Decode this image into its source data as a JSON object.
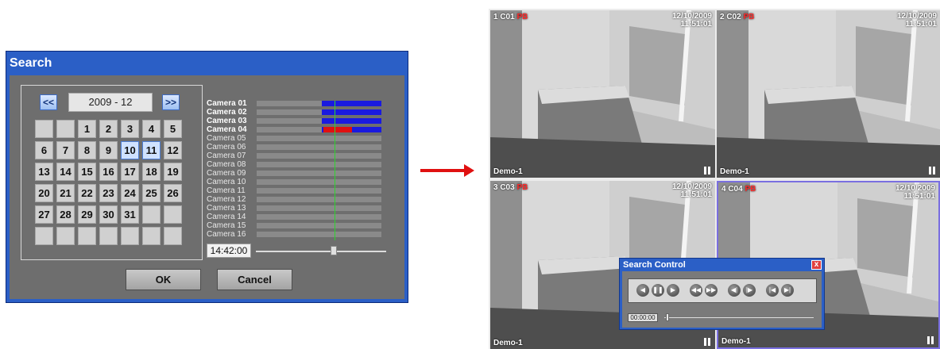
{
  "search_dialog": {
    "title": "Search",
    "prev_label": "<<",
    "next_label": ">>",
    "month": "2009 - 12",
    "days": [
      "",
      "",
      "1",
      "2",
      "3",
      "4",
      "5",
      "6",
      "7",
      "8",
      "9",
      "10",
      "11",
      "12",
      "13",
      "14",
      "15",
      "16",
      "17",
      "18",
      "19",
      "20",
      "21",
      "22",
      "23",
      "24",
      "25",
      "26",
      "27",
      "28",
      "29",
      "30",
      "31",
      "",
      "",
      "",
      "",
      "",
      "",
      "",
      "",
      ""
    ],
    "selected_days": [
      "10",
      "11"
    ],
    "cameras": [
      "Camera 01",
      "Camera 02",
      "Camera 03",
      "Camera 04",
      "Camera 05",
      "Camera 06",
      "Camera 07",
      "Camera 08",
      "Camera 09",
      "Camera 10",
      "Camera 11",
      "Camera 12",
      "Camera 13",
      "Camera 14",
      "Camera 15",
      "Camera 16"
    ],
    "recording_colors": {
      "normal": "#1a1adf",
      "event": "#e01010",
      "cursor": "#2dd42d"
    },
    "time": "14:42:00",
    "ok_label": "OK",
    "cancel_label": "Cancel"
  },
  "camera_views": [
    {
      "id": "1 C01",
      "mode": "PB",
      "date": "12/10/2009",
      "time": "11:51:01",
      "site": "Demo-1"
    },
    {
      "id": "2 C02",
      "mode": "PB",
      "date": "12/10/2009",
      "time": "11:51:01",
      "site": "Demo-1"
    },
    {
      "id": "3 C03",
      "mode": "PB",
      "date": "12/10/2009",
      "time": "11:51:01",
      "site": "Demo-1"
    },
    {
      "id": "4 C04",
      "mode": "PB",
      "date": "12/10/2009",
      "time": "11:51:01",
      "site": "Demo-1"
    }
  ],
  "search_control": {
    "title": "Search Control",
    "close_label": "x",
    "time": "00:00:00",
    "buttons": [
      {
        "name": "reverse-play-icon",
        "glyph": "◀"
      },
      {
        "name": "pause-icon",
        "glyph": "❚❚"
      },
      {
        "name": "play-icon",
        "glyph": "▶"
      },
      {
        "name": "fast-rewind-icon",
        "glyph": "◀◀"
      },
      {
        "name": "fast-forward-icon",
        "glyph": "▶▶"
      },
      {
        "name": "step-back-icon",
        "glyph": "◀|"
      },
      {
        "name": "step-forward-icon",
        "glyph": "|▶"
      },
      {
        "name": "skip-start-icon",
        "glyph": "|◀"
      },
      {
        "name": "skip-end-icon",
        "glyph": "▶|"
      }
    ]
  },
  "accent_color": "#e01010"
}
